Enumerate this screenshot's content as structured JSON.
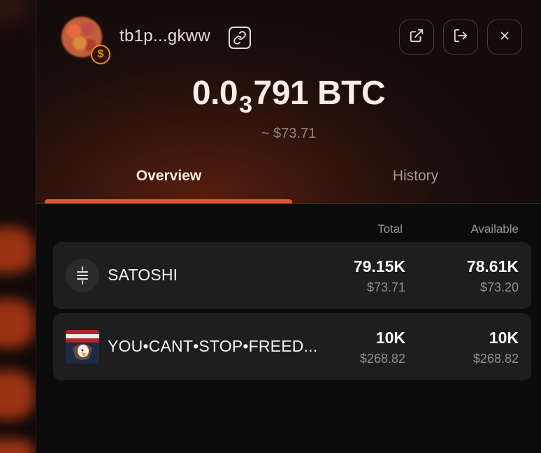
{
  "header": {
    "address": "tb1p...gkww",
    "balance_main": "0.0",
    "balance_sub": "3",
    "balance_tail": "791",
    "balance_unit": "BTC",
    "fiat": "~ $73.71"
  },
  "tabs": [
    {
      "label": "Overview",
      "active": true
    },
    {
      "label": "History",
      "active": false
    }
  ],
  "columns": {
    "total": "Total",
    "available": "Available"
  },
  "assets": [
    {
      "name": "SATOSHI",
      "total": "79.15K",
      "total_fiat": "$73.71",
      "available": "78.61K",
      "available_fiat": "$73.20"
    },
    {
      "name": "YOU•CANT•STOP•FREED...",
      "total": "10K",
      "total_fiat": "$268.82",
      "available": "10K",
      "available_fiat": "$268.82"
    }
  ],
  "colors": {
    "accent": "#e0532c",
    "badge": "#f08a1a",
    "card": "#1e1e1e"
  },
  "icons": [
    "link-icon",
    "external-link-icon",
    "logout-icon",
    "close-icon",
    "satoshi-token-icon"
  ]
}
